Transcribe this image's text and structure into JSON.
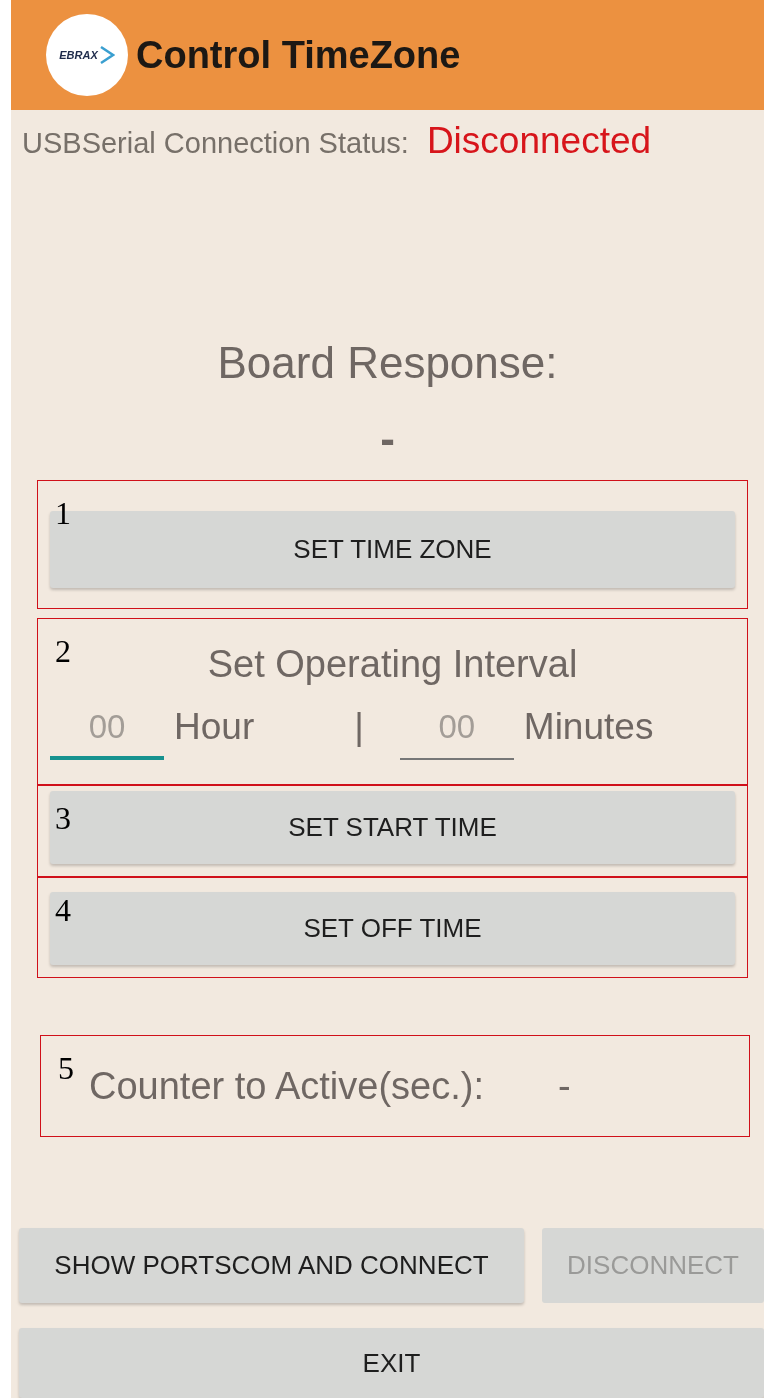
{
  "app_bar": {
    "logo_text": "EBRAX",
    "title": "Control TimeZone"
  },
  "connection_status": {
    "label": "USBSerial Connection Status:",
    "value": "Disconnected"
  },
  "board_response": {
    "label": "Board Response:",
    "value": "-"
  },
  "sections": [
    {
      "marker": "1",
      "kind": "button",
      "label": "SET TIME ZONE"
    },
    {
      "marker": "2",
      "kind": "interval",
      "title": "Set Operating Interval",
      "separator": "|",
      "fields": [
        {
          "placeholder": "00",
          "unit": "Hour",
          "focused": true
        },
        {
          "placeholder": "00",
          "unit": "Minutes",
          "focused": false
        }
      ]
    },
    {
      "marker": "3",
      "kind": "button",
      "label": "SET START TIME"
    },
    {
      "marker": "4",
      "kind": "button",
      "label": "SET OFF TIME"
    },
    {
      "marker": "5",
      "kind": "counter",
      "label": "Counter to Active(sec.):",
      "value": "-"
    }
  ],
  "bottom_buttons": [
    {
      "label": "SHOW PORTSCOM AND CONNECT",
      "disabled": false
    },
    {
      "label": "DISCONNECT",
      "disabled": true
    },
    {
      "label": "EXIT",
      "disabled": false
    }
  ]
}
